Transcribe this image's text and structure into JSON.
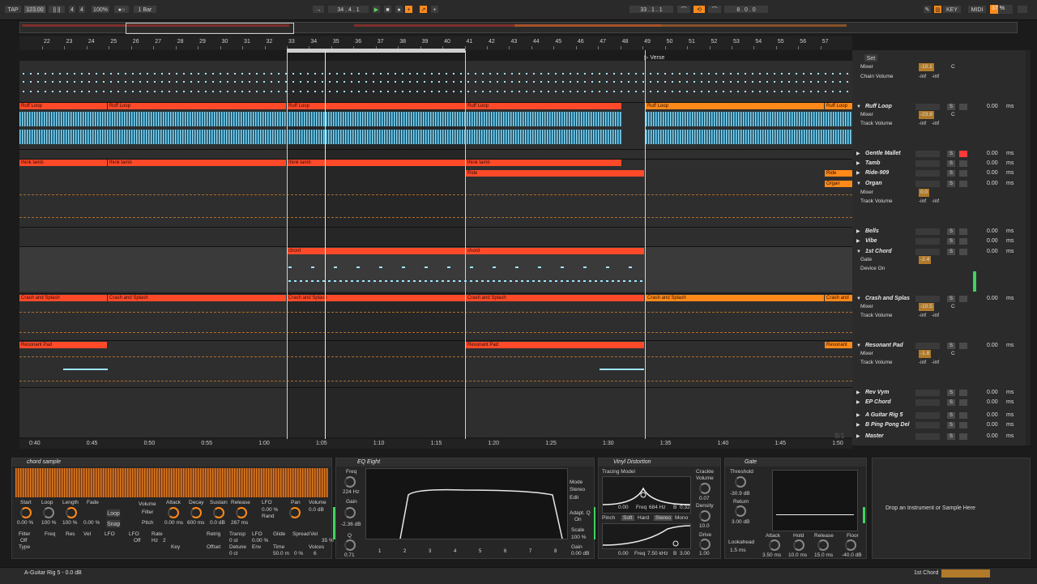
{
  "transport": {
    "tap": "TAP",
    "tempo": "123.00",
    "meter_num": "4",
    "meter_den": "4",
    "zoom": "100%",
    "quantize": "1 Bar",
    "position": "34 . 4 . 1",
    "loop_start": "33 . 1 . 1",
    "loop_length": "8 . 0 . 0",
    "key_label": "KEY",
    "midi_label": "MIDI",
    "cpu": "37 %",
    "cpu_value": 0.37
  },
  "ruler": {
    "bars": [
      "22",
      "23",
      "24",
      "25",
      "26",
      "27",
      "28",
      "29",
      "30",
      "31",
      "32",
      "33",
      "34",
      "35",
      "36",
      "37",
      "38",
      "39",
      "40",
      "41",
      "42",
      "43",
      "44",
      "45",
      "46",
      "47",
      "48",
      "49",
      "50",
      "51",
      "52",
      "53",
      "54",
      "55",
      "56",
      "57"
    ],
    "marker": "Verse",
    "set_label": "Set",
    "times": [
      "0:40",
      "0:45",
      "0:50",
      "0:55",
      "1:00",
      "1:05",
      "1:10",
      "1:15",
      "1:20",
      "1:25",
      "1:30",
      "1:35",
      "1:40",
      "1:45",
      "1:50"
    ],
    "page": "8/1"
  },
  "clips": {
    "ruff": "Ruff Loop",
    "think": "think tamb",
    "ride": "Ride",
    "organ": "Organ",
    "chord": "chord",
    "crash": "Crash and Splash",
    "crash_short": "Crash and",
    "pad": "Resonant Pad",
    "pad_short": "Resonant"
  },
  "tracks": [
    {
      "name": "Ruff Loop",
      "vol": "",
      "ms": "0.00",
      "unit": "ms"
    },
    {
      "name": "Gentle Mallet",
      "vol": "",
      "ms": "0.00",
      "unit": "ms"
    },
    {
      "name": "Tamb",
      "vol": "",
      "ms": "0.00",
      "unit": "ms"
    },
    {
      "name": "Ride-909",
      "vol": "",
      "ms": "0.00",
      "unit": "ms"
    },
    {
      "name": "Organ",
      "vol": "",
      "ms": "0.00",
      "unit": "ms"
    },
    {
      "name": "Bells",
      "vol": "",
      "ms": "0.00",
      "unit": "ms"
    },
    {
      "name": "Vibe",
      "vol": "",
      "ms": "0.00",
      "unit": "ms"
    },
    {
      "name": "1st Chord",
      "vol": "",
      "ms": "0.00",
      "unit": "ms"
    },
    {
      "name": "Crash and Splas",
      "vol": "",
      "ms": "0.00",
      "unit": "ms"
    },
    {
      "name": "Resonant Pad",
      "vol": "",
      "ms": "0.00",
      "unit": "ms"
    },
    {
      "name": "Rev Vym",
      "vol": "",
      "ms": "0.00",
      "unit": "ms"
    },
    {
      "name": "EP Chord",
      "vol": "",
      "ms": "0.00",
      "unit": "ms"
    },
    {
      "name": "A Guitar Rig 5",
      "vol": "",
      "ms": "0.00",
      "unit": "ms"
    },
    {
      "name": "B Ping Pong Del",
      "vol": "",
      "ms": "0.00",
      "unit": "ms"
    },
    {
      "name": "Master",
      "vol": "",
      "ms": "0.00",
      "unit": "ms"
    }
  ],
  "subrows": {
    "mixer": "Mixer",
    "chain_volume": "Chain Volume",
    "track_volume": "Track Volume",
    "gate": "Gate",
    "device_on": "Device On",
    "inf": "-inf",
    "c": "C",
    "v1": "-10.1",
    "v2": "-23.8",
    "v3": "0.0",
    "v4": "-2.4",
    "v5": "-10.5",
    "v6": "-1.8",
    "s": "S",
    "a": "A",
    "b": "B",
    "post": "Post",
    "master_send": "-6.4",
    "zero": "0",
    "ruff_vol": "2"
  },
  "simpler": {
    "title": "chord sample",
    "labels": [
      "Start",
      "Loop",
      "Length",
      "Fade",
      "Volume",
      "Attack",
      "Decay",
      "Sustain",
      "Release",
      "LFO",
      "Pan",
      "Volume"
    ],
    "values": [
      "0.00 %",
      "100 %",
      "100 %",
      "0.00 %",
      "0.00 ms",
      "600 ms",
      "0.0 dB",
      "267 ms",
      "0.00 %",
      "0.0 dB"
    ],
    "filter": "Filter",
    "pitch": "Pitch",
    "loop": "Loop",
    "snap": "Snap",
    "lfo2": "LFO",
    "rate": "Rate",
    "hz": "Hz",
    "rate_val": "2",
    "rand": "Rand",
    "c_val": "C",
    "row2": [
      "Filter",
      "Freq",
      "Res",
      "Vel",
      "LFO",
      "Type",
      "Key",
      "Env",
      "Retrig",
      "Offset",
      "Transp",
      "Detune",
      "LFO",
      "Env",
      "Glide",
      "Time",
      "Spread",
      "Voices",
      "Vel"
    ],
    "row2_vals": [
      "Off",
      "0 st",
      "0 ct",
      "0.00 %",
      "Off",
      "50.0 m",
      "0 %",
      "6",
      "35 %"
    ]
  },
  "eq": {
    "title": "EQ Eight",
    "freq_label": "Freq",
    "freq": "224 Hz",
    "gain_label": "Gain",
    "gain": "-2.36 dB",
    "q_label": "Q",
    "q": "0.71",
    "mode_label": "Mode",
    "mode": "Stereo",
    "edit": "Edit",
    "adapt_q": "Adapt. Q",
    "on": "On",
    "scale_label": "Scale",
    "scale": "100 %",
    "gain2_label": "Gain",
    "gain2": "0.00 dB",
    "bands": [
      "1",
      "2",
      "3",
      "4",
      "5",
      "6",
      "7",
      "8"
    ]
  },
  "vinyl": {
    "title": "Vinyl Distortion",
    "tracing": "Tracing Model",
    "crackle": "Crackle",
    "volume": "Volume",
    "vol_val": "0.07",
    "density": "Density",
    "dens_val": "10.0",
    "drive": "Drive",
    "drive_val": "1.00",
    "pinch": "Pinch",
    "soft": "Soft",
    "hard": "Hard",
    "stereo": "Stereo",
    "mono": "Mono",
    "row1": [
      "0.00",
      "Freq",
      "684 Hz",
      "B",
      "0.32"
    ],
    "row2": [
      "0.00",
      "Freq",
      "7.50 kHz",
      "B",
      "3.00"
    ]
  },
  "gate": {
    "title": "Gate",
    "threshold": "Threshold",
    "thr_val": "-30.9 dB",
    "return": "Return",
    "ret_val": "3.00 dB",
    "lookahead": "Lookahead",
    "look_val": "1.5 ms",
    "attack": "Attack",
    "att_val": "3.50 ms",
    "hold": "Hold",
    "hold_val": "10.0 ms",
    "release": "Release",
    "rel_val": "15.0 ms",
    "floor": "Floor",
    "floor_val": "-40.0 dB"
  },
  "drop_hint": "Drop an Instrument or Sample Here",
  "status": {
    "left": "A-Guitar Rig 5 - 0.0 dB",
    "right": "1st Chord"
  },
  "colors": {
    "clip_red": "#ff4a2a",
    "clip_orange": "#ff8a1a",
    "wave": "#9fe6ff",
    "panel": "#262626"
  }
}
